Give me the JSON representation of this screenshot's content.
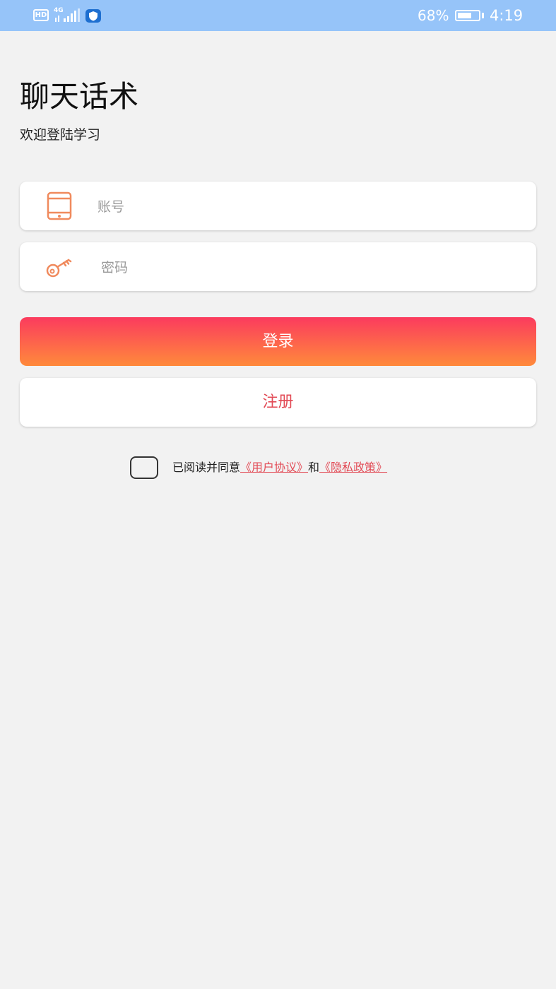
{
  "status_bar": {
    "hd_label": "HD",
    "network_label": "4G",
    "battery_percent": "68%",
    "battery_level": 0.68,
    "time": "4:19",
    "bar_color": "#96c4f9"
  },
  "header": {
    "title": "聊天话术",
    "subtitle": "欢迎登陆学习"
  },
  "form": {
    "account": {
      "placeholder": "账号",
      "icon": "tablet-icon"
    },
    "password": {
      "placeholder": "密码",
      "icon": "key-icon"
    },
    "icon_color": "#f08a5d"
  },
  "buttons": {
    "login_label": "登录",
    "register_label": "注册",
    "login_gradient": [
      "#fb3b5e",
      "#ff8a3b"
    ],
    "register_text_color": "#e24a55"
  },
  "agreement": {
    "prefix": "已阅读并同意",
    "user_agreement": "《用户协议》",
    "conjunction": "和",
    "privacy_policy": "《隐私政策》",
    "checked": false
  }
}
